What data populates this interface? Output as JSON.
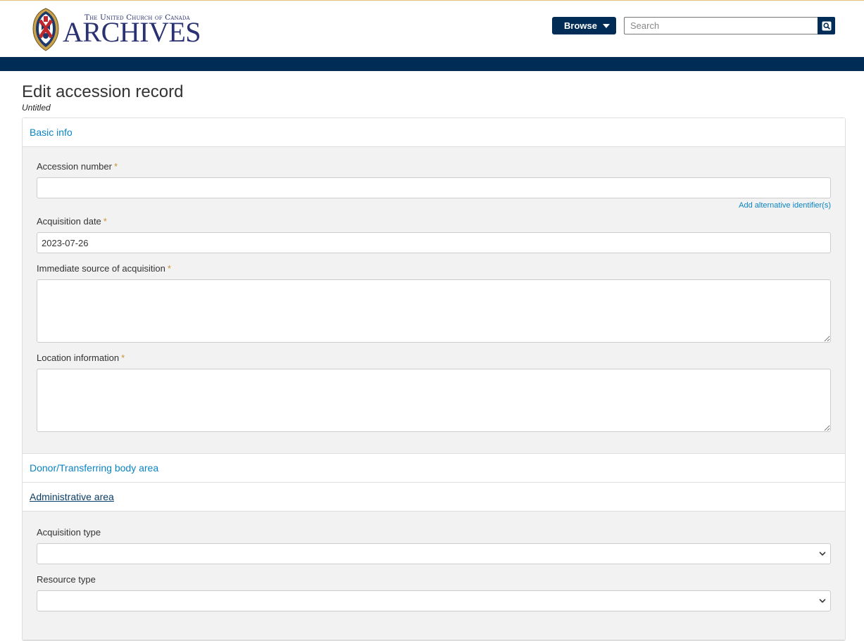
{
  "header": {
    "logo_subtitle": "The United Church of Canada",
    "logo_title": "ARCHIVES",
    "browse_label": "Browse",
    "search_placeholder": "Search"
  },
  "page": {
    "title": "Edit accession record",
    "subtitle": "Untitled"
  },
  "sections": {
    "basic_info": {
      "label": "Basic info",
      "accession_number_label": "Accession number",
      "accession_number_value": "",
      "alt_identifier_link": "Add alternative identifier(s)",
      "acquisition_date_label": "Acquisition date",
      "acquisition_date_value": "2023-07-26",
      "immediate_source_label": "Immediate source of acquisition",
      "location_info_label": "Location information",
      "required_mark": "*"
    },
    "donor": {
      "label": "Donor/Transferring body area"
    },
    "administrative": {
      "label": "Administrative area",
      "acquisition_type_label": "Acquisition type",
      "resource_type_label": "Resource type"
    }
  },
  "colors": {
    "navy": "#002c55",
    "link": "#0a84c1",
    "required": "#c8933a",
    "panel_bg": "#f2f2f2"
  }
}
